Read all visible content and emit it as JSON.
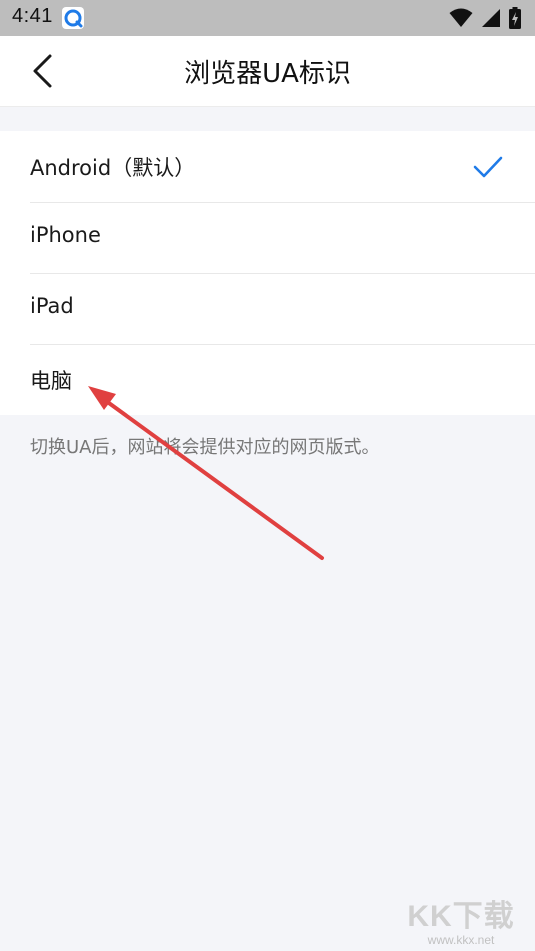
{
  "status_bar": {
    "time": "4:41",
    "icons": [
      "browser-app-icon",
      "wifi-icon",
      "signal-icon",
      "battery-charging-icon"
    ]
  },
  "header": {
    "title": "浏览器UA标识",
    "back_icon": "chevron-left-icon"
  },
  "ua_options": [
    {
      "label": "Android（默认）",
      "selected": true
    },
    {
      "label": "iPhone",
      "selected": false
    },
    {
      "label": "iPad",
      "selected": false
    },
    {
      "label": "电脑",
      "selected": false
    }
  ],
  "hint": "切换UA后，网站将会提供对应的网页版式。",
  "colors": {
    "accent": "#1f7be8",
    "annotation": "#e04040",
    "page_bg": "#f4f5f9",
    "status_bar_bg": "#bdbdbd"
  },
  "watermark": {
    "logo": "KK下载",
    "url": "www.kkx.net"
  }
}
